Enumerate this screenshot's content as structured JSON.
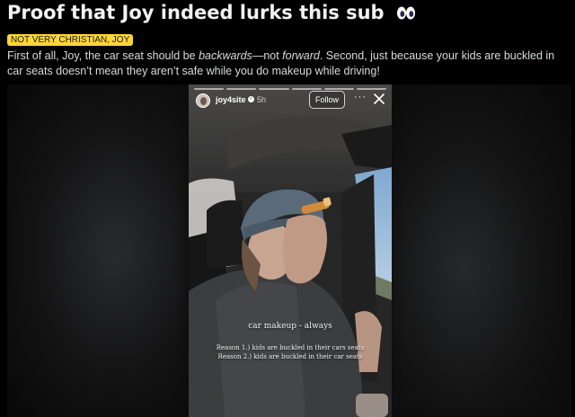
{
  "post": {
    "title": "Proof that Joy indeed lurks this sub",
    "title_emoji": "eyes-icon",
    "flair": "NOT VERY CHRISTIAN, JOY",
    "flair_color": "#ffd635",
    "body": {
      "part1": "First of all, Joy, the car seat should be ",
      "em1": "backwards",
      "part2": "—not ",
      "em2": "forward",
      "part3": ". Second, just because your kids are buckled in car seats doesn’t mean they aren’t safe while you do makeup while driving!"
    }
  },
  "story": {
    "username": "joy4site",
    "time": "5h",
    "follow_label": "Follow",
    "more_label": "···",
    "caption_main": "car makeup - always",
    "caption_line1": "Reason 1.) kids are buckled in their cars seats",
    "caption_line2": "Reason 2.) kids are buckled in their car seats",
    "progress_segments": 6
  }
}
